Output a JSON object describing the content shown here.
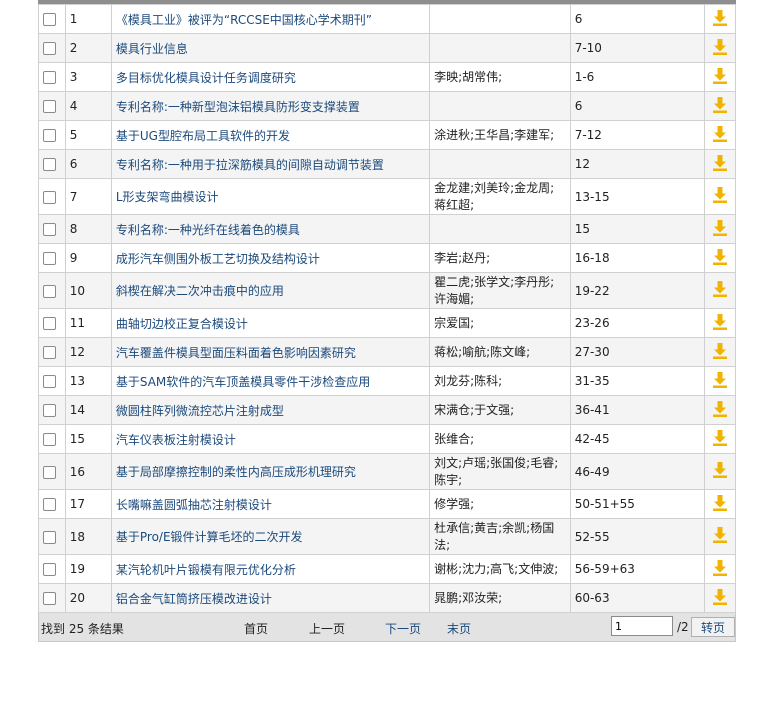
{
  "rows": [
    {
      "num": "1",
      "title": "《模具工业》被评为“RCCSE中国核心学术期刊”",
      "authors": "",
      "pages": "6"
    },
    {
      "num": "2",
      "title": "模具行业信息",
      "authors": "",
      "pages": "7-10"
    },
    {
      "num": "3",
      "title": "多目标优化模具设计任务调度研究",
      "authors": "李映;胡常伟;",
      "pages": "1-6"
    },
    {
      "num": "4",
      "title": "专利名称:一种新型泡沫铝模具防形变支撑装置",
      "authors": "",
      "pages": "6"
    },
    {
      "num": "5",
      "title": "基于UG型腔布局工具软件的开发",
      "authors": "涂进秋;王华昌;李建军;",
      "pages": "7-12"
    },
    {
      "num": "6",
      "title": "专利名称:一种用于拉深筋模具的间隙自动调节装置",
      "authors": "",
      "pages": "12"
    },
    {
      "num": "7",
      "title": "L形支架弯曲模设计",
      "authors": "金龙建;刘美玲;金龙周;蒋红超;",
      "pages": "13-15"
    },
    {
      "num": "8",
      "title": "专利名称:一种光纤在线着色的模具",
      "authors": "",
      "pages": "15"
    },
    {
      "num": "9",
      "title": "成形汽车侧围外板工艺切换及结构设计",
      "authors": "李岩;赵丹;",
      "pages": "16-18"
    },
    {
      "num": "10",
      "title": "斜楔在解决二次冲击痕中的应用",
      "authors": "瞿二虎;张学文;李丹彤;许海媚;",
      "pages": "19-22"
    },
    {
      "num": "11",
      "title": "曲轴切边校正复合模设计",
      "authors": "宗爱国;",
      "pages": "23-26"
    },
    {
      "num": "12",
      "title": "汽车覆盖件模具型面压料面着色影响因素研究",
      "authors": "蒋松;喻航;陈文峰;",
      "pages": "27-30"
    },
    {
      "num": "13",
      "title": "基于SAM软件的汽车顶盖模具零件干涉检查应用",
      "authors": "刘龙芬;陈科;",
      "pages": "31-35"
    },
    {
      "num": "14",
      "title": "微圆柱阵列微流控芯片注射成型",
      "authors": "宋满仓;于文强;",
      "pages": "36-41"
    },
    {
      "num": "15",
      "title": "汽车仪表板注射模设计",
      "authors": "张维合;",
      "pages": "42-45"
    },
    {
      "num": "16",
      "title": "基于局部摩擦控制的柔性内高压成形机理研究",
      "authors": "刘文;卢瑶;张国俊;毛睿;陈宇;",
      "pages": "46-49"
    },
    {
      "num": "17",
      "title": "长嘴嘛盖圆弧抽芯注射模设计",
      "authors": "修学强;",
      "pages": "50-51+55"
    },
    {
      "num": "18",
      "title": "基于Pro/E锻件计算毛坯的二次开发",
      "authors": "杜承信;黄吉;余凯;杨国法;",
      "pages": "52-55"
    },
    {
      "num": "19",
      "title": "某汽轮机叶片锻模有限元优化分析",
      "authors": "谢彬;沈力;高飞;文伸波;",
      "pages": "56-59+63"
    },
    {
      "num": "20",
      "title": "铝合金气缸筒挤压模改进设计",
      "authors": "晁鹏;邓汝荣;",
      "pages": "60-63"
    }
  ],
  "footer": {
    "result_count": "找到 25 条结果",
    "first": "首页",
    "prev": "上一页",
    "next": "下一页",
    "last": "末页",
    "page_value": "1",
    "total_pages": "/2",
    "go": "转页"
  },
  "colors": {
    "link": "#1c4a7c",
    "download_icon": "#f0b400"
  },
  "icons": {
    "download": "download-icon"
  }
}
